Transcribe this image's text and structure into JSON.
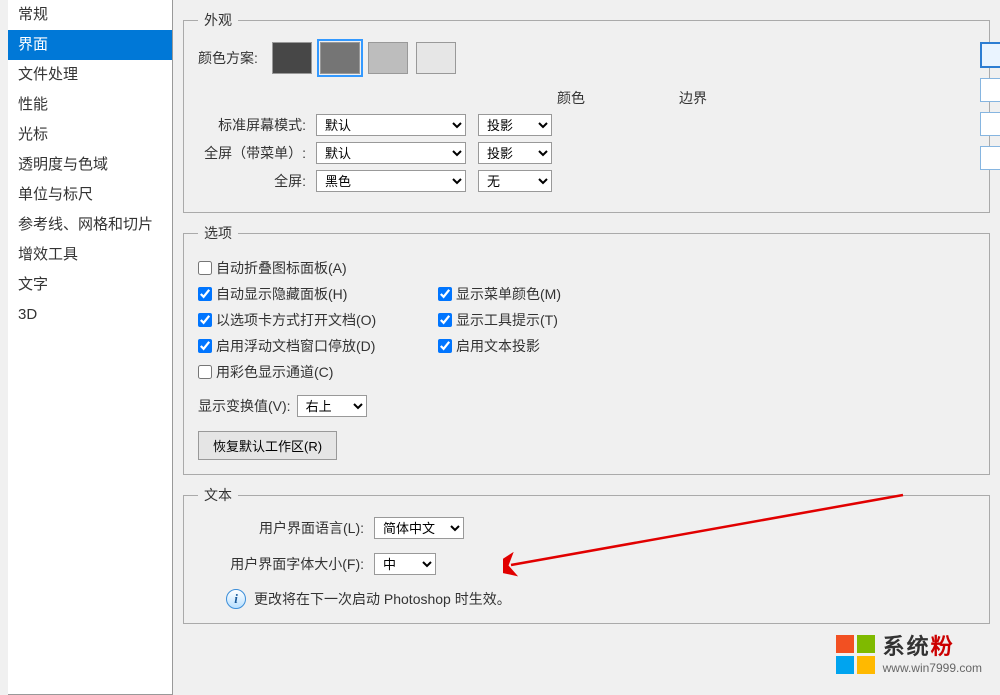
{
  "sidebar": {
    "items": [
      {
        "label": "常规"
      },
      {
        "label": "界面",
        "selected": true
      },
      {
        "label": "文件处理"
      },
      {
        "label": "性能"
      },
      {
        "label": "光标"
      },
      {
        "label": "透明度与色域"
      },
      {
        "label": "单位与标尺"
      },
      {
        "label": "参考线、网格和切片"
      },
      {
        "label": "增效工具"
      },
      {
        "label": "文字"
      },
      {
        "label": "3D"
      }
    ]
  },
  "appearance": {
    "legend": "外观",
    "color_scheme_label": "颜色方案:",
    "header_color": "颜色",
    "header_border": "边界",
    "modes": [
      {
        "label": "标准屏幕模式:",
        "color": "默认",
        "border": "投影"
      },
      {
        "label": "全屏（带菜单）:",
        "color": "默认",
        "border": "投影"
      },
      {
        "label": "全屏:",
        "color": "黑色",
        "border": "无"
      }
    ]
  },
  "options": {
    "legend": "选项",
    "checkboxes": {
      "auto_collapse": {
        "label": "自动折叠图标面板(A)",
        "checked": false
      },
      "auto_show_hidden": {
        "label": "自动显示隐藏面板(H)",
        "checked": true
      },
      "show_menu_colors": {
        "label": "显示菜单颜色(M)",
        "checked": true
      },
      "open_tabs": {
        "label": "以选项卡方式打开文档(O)",
        "checked": true
      },
      "show_tooltips": {
        "label": "显示工具提示(T)",
        "checked": true
      },
      "enable_dock": {
        "label": "启用浮动文档窗口停放(D)",
        "checked": true
      },
      "enable_text_shadow": {
        "label": "启用文本投影",
        "checked": true
      },
      "color_channels": {
        "label": "用彩色显示通道(C)",
        "checked": false
      }
    },
    "transform_label": "显示变换值(V):",
    "transform_value": "右上",
    "restore_button": "恢复默认工作区(R)"
  },
  "text_section": {
    "legend": "文本",
    "ui_lang_label": "用户界面语言(L):",
    "ui_lang_value": "简体中文",
    "ui_font_label": "用户界面字体大小(F):",
    "ui_font_value": "中",
    "note": "更改将在下一次启动 Photoshop 时生效。"
  },
  "watermark": {
    "title_main": "系统",
    "title_accent": "粉",
    "sub": "www.win7999.com"
  }
}
